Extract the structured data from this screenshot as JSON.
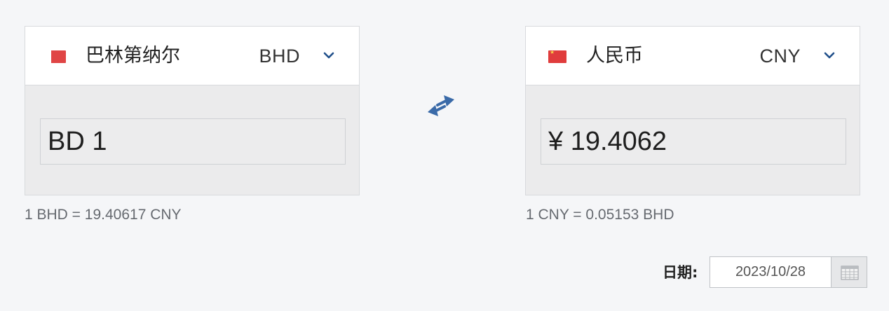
{
  "from": {
    "currency_name": "巴林第纳尔",
    "currency_code": "BHD",
    "amount": "BD 1",
    "rate_text": "1 BHD = 19.40617 CNY",
    "flag_icon": "bahrain-flag-icon"
  },
  "to": {
    "currency_name": "人民币",
    "currency_code": "CNY",
    "amount": "¥ 19.4062",
    "rate_text": "1 CNY = 0.05153 BHD",
    "flag_icon": "china-flag-icon"
  },
  "date": {
    "label": "日期:",
    "value": "2023/10/28"
  },
  "colors": {
    "accent": "#1f4f8a",
    "swap_arrow": "#3a6aa8",
    "flag_red": "#e03c3c"
  }
}
